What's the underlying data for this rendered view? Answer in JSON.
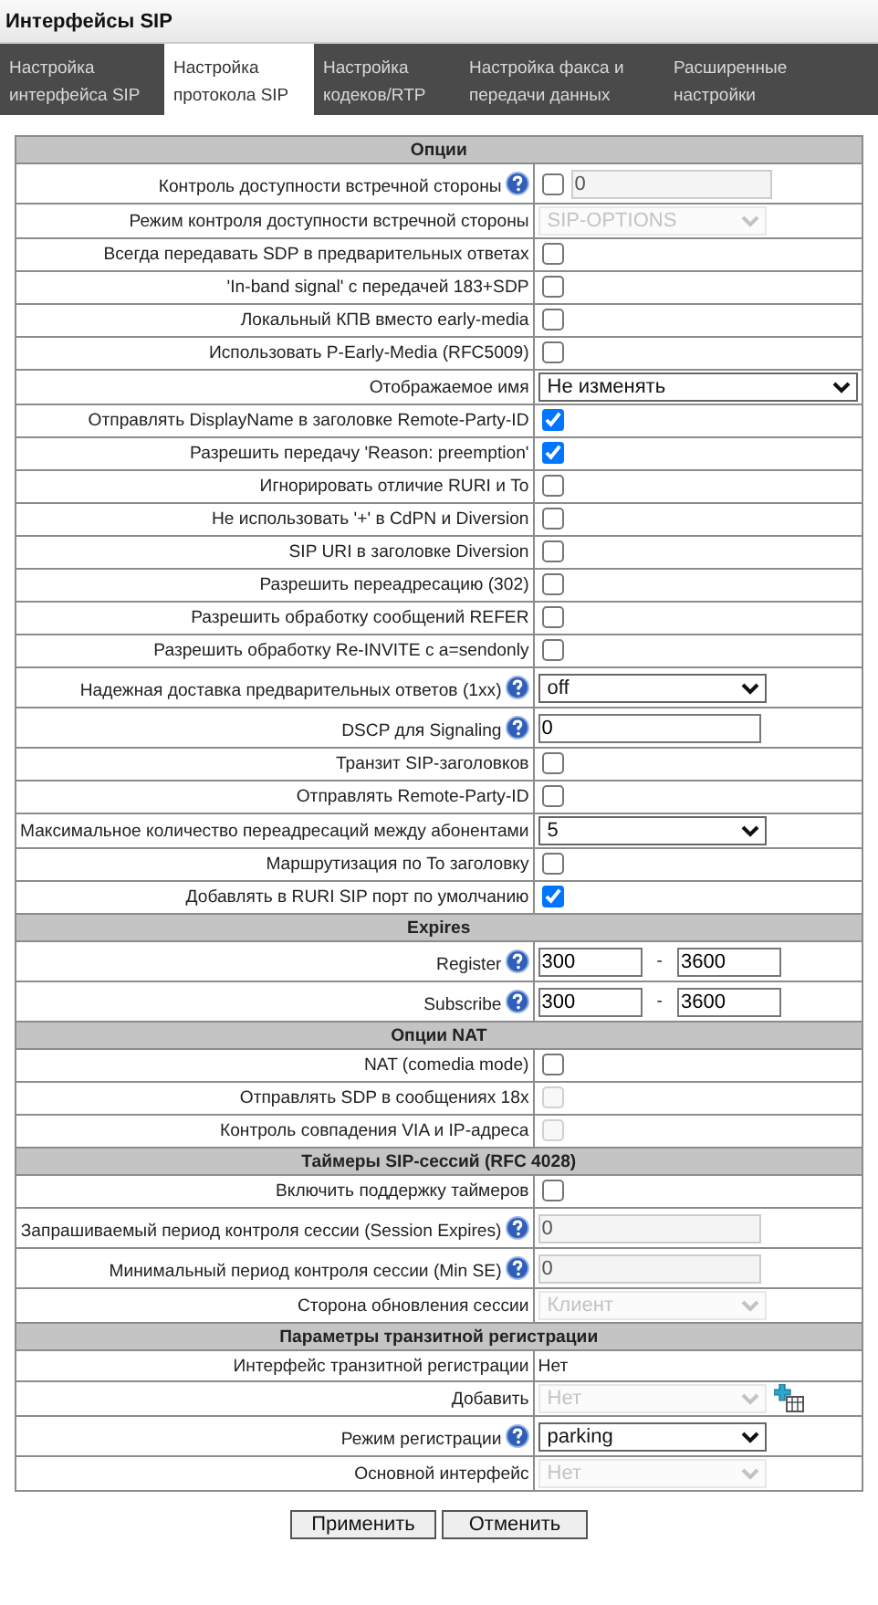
{
  "window": {
    "title": "Интерфейсы SIP"
  },
  "tabs": [
    {
      "label": "Настройка интерфейса SIP",
      "selected": false
    },
    {
      "label": "Настройка протокола SIP",
      "selected": true
    },
    {
      "label": "Настройка кодеков/RTP",
      "selected": false
    },
    {
      "label": "Настройка факса и передачи данных",
      "selected": false
    },
    {
      "label": "Расширенные настройки",
      "selected": false
    }
  ],
  "sections": [
    {
      "title": "Опции",
      "rows": [
        {
          "kind": "check_text",
          "label": "Контроль доступности встречной стороны",
          "help": true,
          "checked": false,
          "value": "0",
          "disabled": true
        },
        {
          "kind": "select",
          "label": "Режим контроля доступности встречной стороны",
          "value": "SIP-OPTIONS",
          "disabled": true
        },
        {
          "kind": "checkbox",
          "label": "Всегда передавать SDP в предварительных ответах",
          "checked": false,
          "disabled": false
        },
        {
          "kind": "checkbox",
          "label": "'In-band signal' с передачей 183+SDP",
          "checked": false,
          "disabled": false
        },
        {
          "kind": "checkbox",
          "label": "Локальный КПВ вместо early-media",
          "checked": false,
          "disabled": false
        },
        {
          "kind": "checkbox",
          "label": "Использовать P-Early-Media (RFC5009)",
          "checked": false,
          "disabled": false
        },
        {
          "kind": "wide_select",
          "label": "Отображаемое имя",
          "value": "Не изменять",
          "disabled": false
        },
        {
          "kind": "checkbox",
          "label": "Отправлять DisplayName в заголовке Remote-Party-ID",
          "checked": true,
          "disabled": false
        },
        {
          "kind": "checkbox",
          "label": "Разрешить передачу 'Reason: preemption'",
          "checked": true,
          "disabled": false
        },
        {
          "kind": "checkbox",
          "label": "Игнорировать отличие RURI и To",
          "checked": false,
          "disabled": false
        },
        {
          "kind": "checkbox",
          "label": "Не использовать '+' в CdPN и Diversion",
          "checked": false,
          "disabled": false
        },
        {
          "kind": "checkbox",
          "label": "SIP URI в заголовке Diversion",
          "checked": false,
          "disabled": false
        },
        {
          "kind": "checkbox",
          "label": "Разрешить переадресацию (302)",
          "checked": false,
          "disabled": false
        },
        {
          "kind": "checkbox",
          "label": "Разрешить обработку сообщений REFER",
          "checked": false,
          "disabled": false
        },
        {
          "kind": "checkbox",
          "label": "Разрешить обработку Re-INVITE с a=sendonly",
          "checked": false,
          "disabled": false
        },
        {
          "kind": "select",
          "label": "Надежная доставка предварительных ответов (1xx)",
          "help": true,
          "value": "off",
          "disabled": false
        },
        {
          "kind": "text",
          "label": "DSCP для Signaling",
          "help": true,
          "value": "0",
          "disabled": false
        },
        {
          "kind": "checkbox",
          "label": "Транзит SIP-заголовков",
          "checked": false,
          "disabled": false
        },
        {
          "kind": "checkbox",
          "label": "Отправлять Remote-Party-ID",
          "checked": false,
          "disabled": false
        },
        {
          "kind": "select",
          "label": "Максимальное количество переадресаций между абонентами",
          "value": "5",
          "disabled": false
        },
        {
          "kind": "checkbox",
          "label": "Маршрутизация по To заголовку",
          "checked": false,
          "disabled": false
        },
        {
          "kind": "checkbox",
          "label": "Добавлять в RURI SIP порт по умолчанию",
          "checked": true,
          "disabled": false
        }
      ]
    },
    {
      "title": "Expires",
      "rows": [
        {
          "kind": "range",
          "label": "Register",
          "help": true,
          "from": "300",
          "separator": "-",
          "to": "3600"
        },
        {
          "kind": "range",
          "label": "Subscribe",
          "help": true,
          "from": "300",
          "separator": "-",
          "to": "3600"
        }
      ]
    },
    {
      "title": "Опции NAT",
      "rows": [
        {
          "kind": "checkbox",
          "label": "NAT (comedia mode)",
          "checked": false,
          "disabled": false
        },
        {
          "kind": "checkbox",
          "label": "Отправлять SDP в сообщениях 18x",
          "checked": false,
          "disabled": true
        },
        {
          "kind": "checkbox",
          "label": "Контроль совпадения VIA и IP-адреса",
          "checked": false,
          "disabled": true
        }
      ]
    },
    {
      "title": "Таймеры SIP-сессий (RFC 4028)",
      "rows": [
        {
          "kind": "checkbox",
          "label": "Включить поддержку таймеров",
          "checked": false,
          "disabled": false
        },
        {
          "kind": "text",
          "label": "Запрашиваемый период контроля сессии (Session Expires)",
          "help": true,
          "value": "0",
          "disabled": true
        },
        {
          "kind": "text",
          "label": "Минимальный период контроля сессии (Min SE)",
          "help": true,
          "value": "0",
          "disabled": true
        },
        {
          "kind": "select",
          "label": "Сторона обновления сессии",
          "value": "Клиент",
          "disabled": true
        }
      ]
    },
    {
      "title": "Параметры транзитной регистрации",
      "rows": [
        {
          "kind": "plain",
          "label": "Интерфейс транзитной регистрации",
          "value": "Нет"
        },
        {
          "kind": "select_add",
          "label": "Добавить",
          "value": "Нет",
          "disabled": true
        },
        {
          "kind": "select",
          "label": "Режим регистрации",
          "help": true,
          "value": "parking",
          "disabled": false
        },
        {
          "kind": "select",
          "label": "Основной интерфейс",
          "value": "Нет",
          "disabled": true
        }
      ]
    }
  ],
  "buttons": [
    "Применить",
    "Отменить"
  ]
}
